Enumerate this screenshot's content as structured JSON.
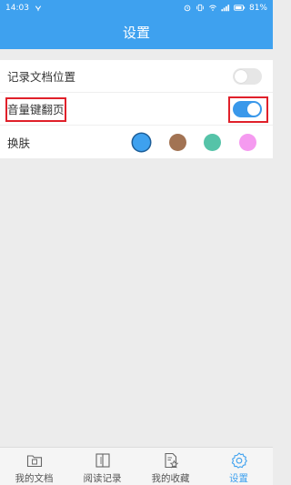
{
  "status_bar": {
    "time": "14:03",
    "battery": "81%"
  },
  "header": {
    "title": "设置"
  },
  "settings": {
    "record_position": {
      "label": "记录文档位置",
      "enabled": false
    },
    "volume_key": {
      "label": "音量键翻页",
      "enabled": true
    },
    "skin": {
      "label": "换肤",
      "swatches": [
        "#3ea1ef",
        "#a27353",
        "#55c3a8",
        "#f59af0"
      ],
      "selected": 0
    }
  },
  "tabs": [
    {
      "label": "我的文档",
      "icon": "folder-icon",
      "active": false
    },
    {
      "label": "阅读记录",
      "icon": "book-icon",
      "active": false
    },
    {
      "label": "我的收藏",
      "icon": "star-document-icon",
      "active": false
    },
    {
      "label": "设置",
      "icon": "gear-icon",
      "active": true
    }
  ],
  "colors": {
    "primary": "#3ea1ef",
    "highlight": "#e0202a"
  }
}
